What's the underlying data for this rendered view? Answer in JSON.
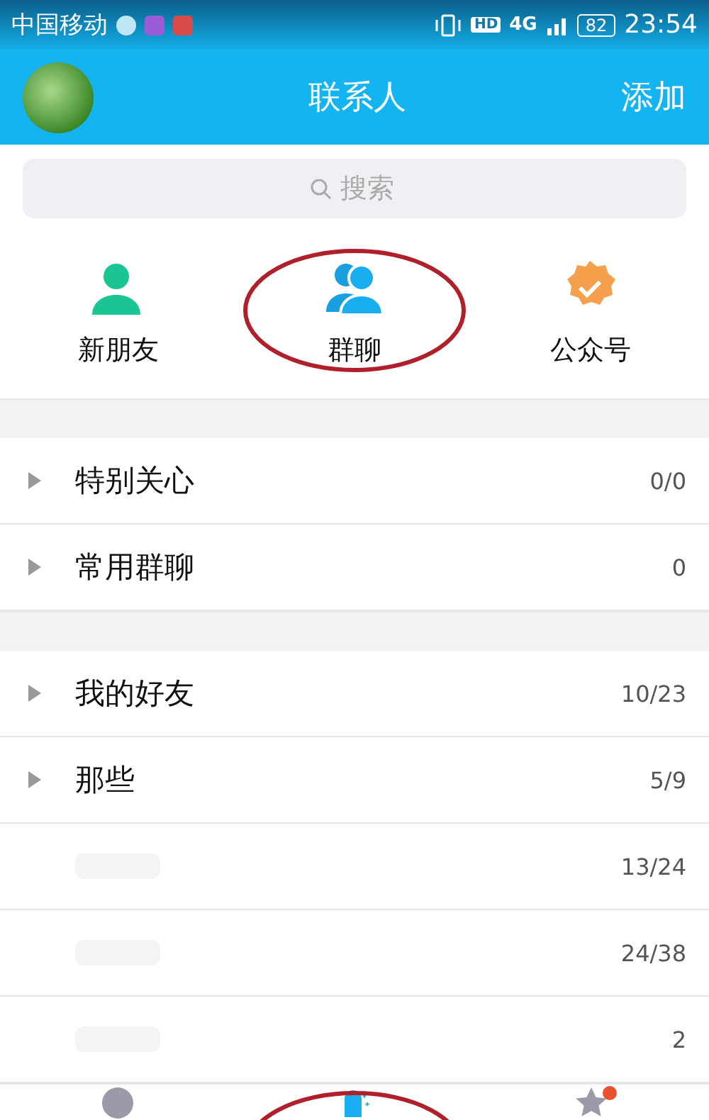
{
  "status_bar": {
    "carrier": "中国移动",
    "hd": "HD",
    "network": "4G",
    "battery": "82",
    "time": "23:54"
  },
  "header": {
    "title": "联系人",
    "action": "添加"
  },
  "search": {
    "placeholder": "搜索"
  },
  "shortcuts": [
    {
      "kind": "new-friend",
      "label": "新朋友"
    },
    {
      "kind": "group-chat",
      "label": "群聊",
      "circled": true
    },
    {
      "kind": "official",
      "label": "公众号"
    }
  ],
  "sections": [
    {
      "groups": [
        {
          "kind": "named",
          "name": "特别关心",
          "count": "0/0",
          "expanded": false
        },
        {
          "kind": "named",
          "name": "常用群聊",
          "count": "0",
          "expanded": false
        }
      ]
    },
    {
      "groups": [
        {
          "kind": "named",
          "name": "我的好友",
          "count": "10/23",
          "expanded": false
        },
        {
          "kind": "named",
          "name": "那些",
          "count": "5/9",
          "expanded": false
        },
        {
          "kind": "blurred",
          "count": "13/24"
        },
        {
          "kind": "blurred",
          "count": "24/38"
        },
        {
          "kind": "blurred",
          "count": "2"
        }
      ]
    }
  ],
  "bottom_nav": [
    {
      "kind": "messages",
      "selected": false
    },
    {
      "kind": "contacts",
      "selected": true,
      "circled": true
    },
    {
      "kind": "dynamic",
      "selected": false,
      "badge": true
    }
  ]
}
